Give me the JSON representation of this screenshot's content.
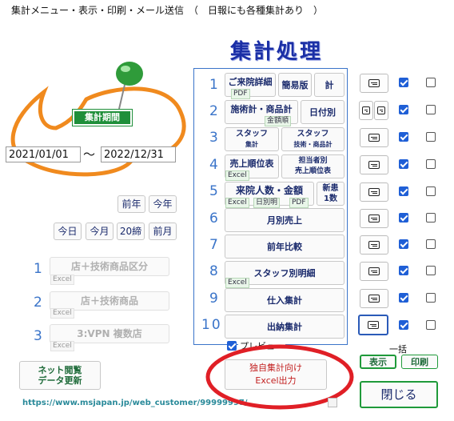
{
  "window": {
    "title": "集計メニュー・表示・印刷・メール送信　（　日報にも各種集計あり　）"
  },
  "heading": "集計処理",
  "period": {
    "label": "集計期間",
    "from": "2021/01/01",
    "separator": "～",
    "to": "2022/12/31"
  },
  "quick_buttons": [
    "前年",
    "今年",
    "今日",
    "今月",
    "20締",
    "前月"
  ],
  "left_reports": [
    {
      "num": "1",
      "label": "店＋技術商品区分",
      "tag": "Excel"
    },
    {
      "num": "2",
      "label": "店＋技術商品",
      "tag": "Excel"
    },
    {
      "num": "3",
      "label": "3:VPN 複数店",
      "tag": "Excel"
    }
  ],
  "net_button": {
    "line1": "ネット閲覧",
    "line2": "データ更新"
  },
  "url": "https://www.msjapan.jp/web_customer/99999997/",
  "rows": [
    {
      "num": "1",
      "checked": true,
      "buttons": [
        {
          "label": "ご来院詳細",
          "tag": "PDF"
        },
        {
          "label": "簡易版"
        },
        {
          "label": "計"
        }
      ]
    },
    {
      "num": "2",
      "checked": true,
      "buttons": [
        {
          "label": "施術計・商品計",
          "tag": "金額順"
        },
        {
          "label": "日付別"
        }
      ]
    },
    {
      "num": "3",
      "checked": true,
      "buttons": [
        {
          "line1": "スタッフ",
          "line2": "集計"
        },
        {
          "line1": "スタッフ",
          "line2": "技術・商品計"
        }
      ]
    },
    {
      "num": "4",
      "checked": true,
      "buttons": [
        {
          "label": "売上順位表",
          "tag": "Excel"
        },
        {
          "line1": "担当者別",
          "line2": "売上順位表"
        }
      ]
    },
    {
      "num": "5",
      "checked": true,
      "buttons": [
        {
          "label": "来院人数・金額",
          "tags": [
            "Excel",
            "日別明",
            "PDF"
          ]
        },
        {
          "line1": "新患",
          "line2": "1数"
        }
      ]
    },
    {
      "num": "6",
      "checked": true,
      "buttons": [
        {
          "label": "月別売上"
        }
      ]
    },
    {
      "num": "7",
      "checked": true,
      "buttons": [
        {
          "label": "前年比較"
        }
      ]
    },
    {
      "num": "8",
      "checked": true,
      "buttons": [
        {
          "label": "スタッフ別明細",
          "tag": "Excel"
        }
      ]
    },
    {
      "num": "9",
      "checked": true,
      "buttons": [
        {
          "label": "仕入集計"
        }
      ]
    },
    {
      "num": "10",
      "checked": true,
      "buttons": [
        {
          "label": "出納集計"
        }
      ]
    }
  ],
  "preview_label": "プレビュー",
  "preview_checked": true,
  "custom_button": {
    "line1": "独自集計向け",
    "line2": "Excel出力"
  },
  "bulk": {
    "label": "一括",
    "display": "表示",
    "print": "印刷"
  },
  "close_label": "閉じる",
  "colors": {
    "accent_green": "#1f9a3a",
    "title_blue": "#1b2fa6",
    "cloud_orange": "#f08a1e",
    "ellipse_red": "#e01f26"
  }
}
